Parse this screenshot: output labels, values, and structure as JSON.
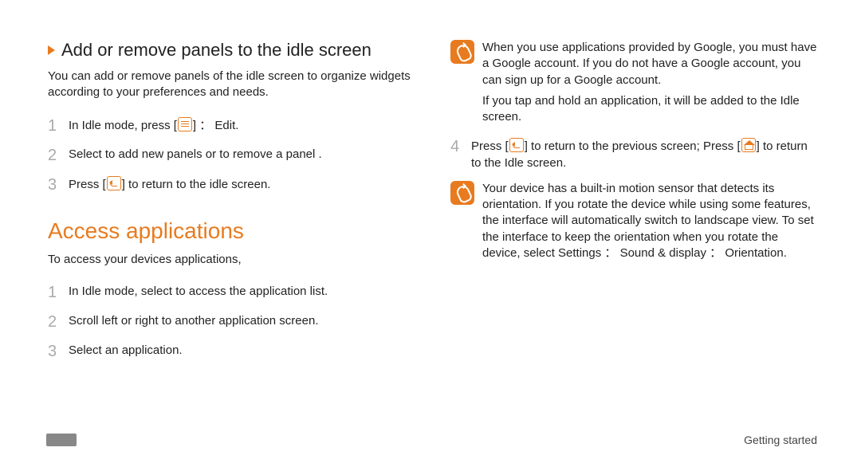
{
  "left": {
    "heading": "Add or remove panels to the idle screen",
    "subtext": "You can add or remove panels of the idle screen to organize widgets according to your preferences and needs.",
    "steps": [
      {
        "n": "1",
        "pre": "In Idle mode, press [",
        "mid": "] ： ",
        "post": "Edit."
      },
      {
        "n": "2",
        "text": "Select        to add new panels or        to remove a panel ."
      },
      {
        "n": "3",
        "pre": "Press [",
        "post": "] to return to the idle screen."
      }
    ],
    "heading2": "Access applications",
    "sub2": "To access your devices applications,",
    "steps2": [
      {
        "n": "1",
        "text": "In Idle mode, select         to access the application list."
      },
      {
        "n": "2",
        "text": "Scroll left or right to another application screen."
      },
      {
        "n": "3",
        "text": "Select an application."
      }
    ]
  },
  "right": {
    "note1": "When you use applications provided by Google, you must have a Google account. If you do not have a Google account, you can sign up for a Google account.",
    "note1b": "If you tap and hold an application, it will be added to the Idle screen.",
    "step4": {
      "n": "4",
      "pre": "Press [",
      "mid": "] to return to the previous screen; Press [",
      "post": "] to return to the Idle screen."
    },
    "note2": "Your device has a built-in motion sensor that detects its orientation. If you rotate the device while using some features, the interface will automatically switch to landscape view. To set the interface to keep the orientation when you rotate the device, select Settings ： Sound & display ： Orientation."
  },
  "footer": "Getting started"
}
